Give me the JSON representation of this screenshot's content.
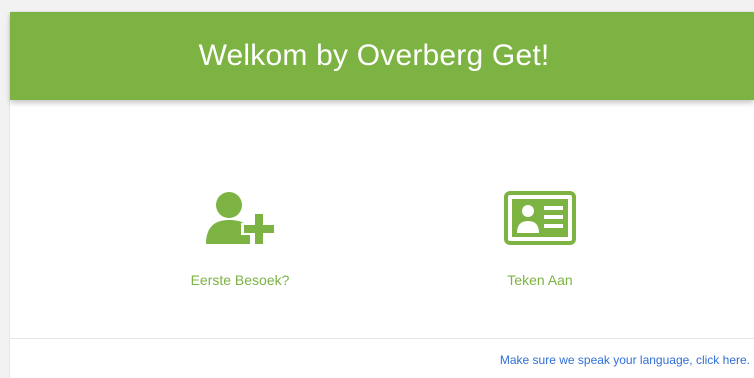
{
  "header": {
    "title": "Welkom by Overberg Get!"
  },
  "options": [
    {
      "label": "Eerste Besoek?",
      "icon": "add-user-icon"
    },
    {
      "label": "Teken Aan",
      "icon": "id-card-icon"
    }
  ],
  "footer": {
    "language_link": "Make sure we speak your language, click here."
  },
  "colors": {
    "accent": "#7cb342",
    "link": "#2f6fd6",
    "background": "#ffffff"
  }
}
